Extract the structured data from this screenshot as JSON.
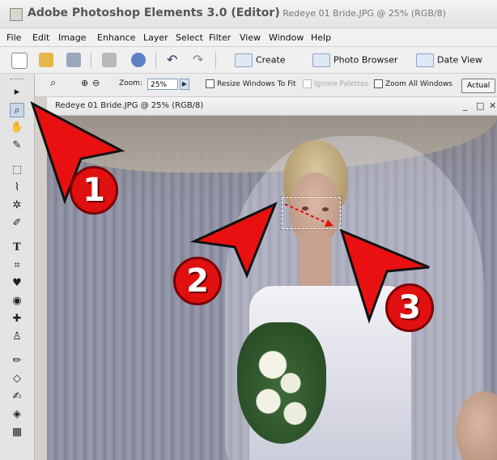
{
  "window": {
    "title": "Adobe Photoshop Elements 3.0 (Editor)",
    "title_suffix": " Redeye 01 Bride.JPG @ 25% (RGB/8)"
  },
  "menu": [
    "File",
    "Edit",
    "Image",
    "Enhance",
    "Layer",
    "Select",
    "Filter",
    "View",
    "Window",
    "Help"
  ],
  "toolbar": {
    "create": "Create",
    "photo_browser": "Photo Browser",
    "date_view": "Date View"
  },
  "options": {
    "zoom_label": "Zoom:",
    "zoom_value": "25%",
    "resize_windows": "Resize Windows To Fit",
    "ignore_palettes": "Ignore Palettes",
    "zoom_all_windows": "Zoom All Windows",
    "actual_pixels": "Actual"
  },
  "document": {
    "title": "Redeye 01 Bride.JPG @ 25% (RGB/8)",
    "minimize": "_",
    "maximize": "□",
    "close": "✕"
  },
  "tools": {
    "move": "▸",
    "zoom": "⌕",
    "hand": "✋",
    "eyedropper": "✎",
    "marquee": "⬚",
    "lasso": "⌇",
    "magic_wand": "✲",
    "selection_brush": "✐",
    "type": "T",
    "crop": "⌗",
    "cookie_cutter": "♥",
    "red_eye": "◉",
    "healing": "✚",
    "clone_stamp": "♙",
    "pencil": "✏",
    "eraser": "◇",
    "brush": "✍",
    "paint_bucket": "◈",
    "gradient": "▦"
  },
  "annotations": [
    "1",
    "2",
    "3"
  ],
  "colors": {
    "annotation_red": "#e01010",
    "annotation_border": "#7a0000"
  }
}
